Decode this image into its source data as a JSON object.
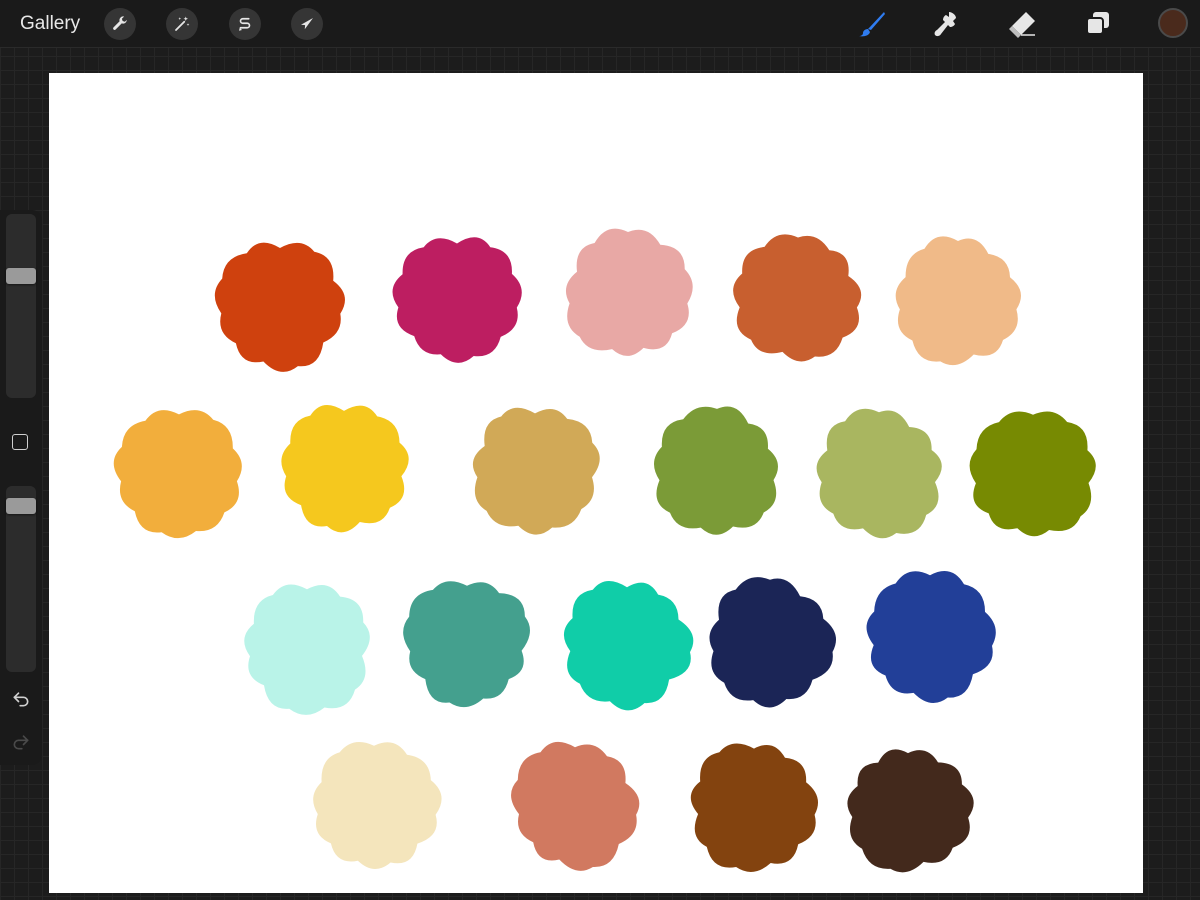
{
  "toolbar": {
    "gallery_label": "Gallery",
    "left_tools": [
      {
        "name": "actions-wrench-icon"
      },
      {
        "name": "adjustments-wand-icon"
      },
      {
        "name": "selection-s-icon"
      },
      {
        "name": "transform-arrow-icon"
      }
    ],
    "right_tools": [
      {
        "name": "brush-icon",
        "active": true
      },
      {
        "name": "smudge-icon"
      },
      {
        "name": "eraser-icon"
      },
      {
        "name": "layers-icon"
      }
    ],
    "current_color": "#4a2a1c"
  },
  "sidebar": {
    "brush_size_slider": {
      "value": 0.68
    },
    "opacity_slider": {
      "value": 0.93
    },
    "modify_button": {
      "name": "square-outline-icon"
    },
    "undo": {
      "name": "undo-icon"
    },
    "redo": {
      "name": "redo-icon",
      "enabled": false
    }
  },
  "canvas": {
    "background": "#ffffff",
    "swatches": [
      {
        "row": 1,
        "color": "#cf410e"
      },
      {
        "row": 1,
        "color": "#bd1e61"
      },
      {
        "row": 1,
        "color": "#e8a8a5"
      },
      {
        "row": 1,
        "color": "#c85f2f"
      },
      {
        "row": 1,
        "color": "#f0ba88"
      },
      {
        "row": 2,
        "color": "#f2ae3c"
      },
      {
        "row": 2,
        "color": "#f5c81e"
      },
      {
        "row": 2,
        "color": "#d1a957"
      },
      {
        "row": 2,
        "color": "#7b9b37"
      },
      {
        "row": 2,
        "color": "#a9b660"
      },
      {
        "row": 2,
        "color": "#778a02"
      },
      {
        "row": 3,
        "color": "#b9f3e8"
      },
      {
        "row": 3,
        "color": "#44a08e"
      },
      {
        "row": 3,
        "color": "#10cda8"
      },
      {
        "row": 3,
        "color": "#1b2556"
      },
      {
        "row": 3,
        "color": "#223f98"
      },
      {
        "row": 4,
        "color": "#f4e5bc"
      },
      {
        "row": 4,
        "color": "#d17960"
      },
      {
        "row": 4,
        "color": "#83430f"
      },
      {
        "row": 4,
        "color": "#43291c"
      }
    ]
  }
}
